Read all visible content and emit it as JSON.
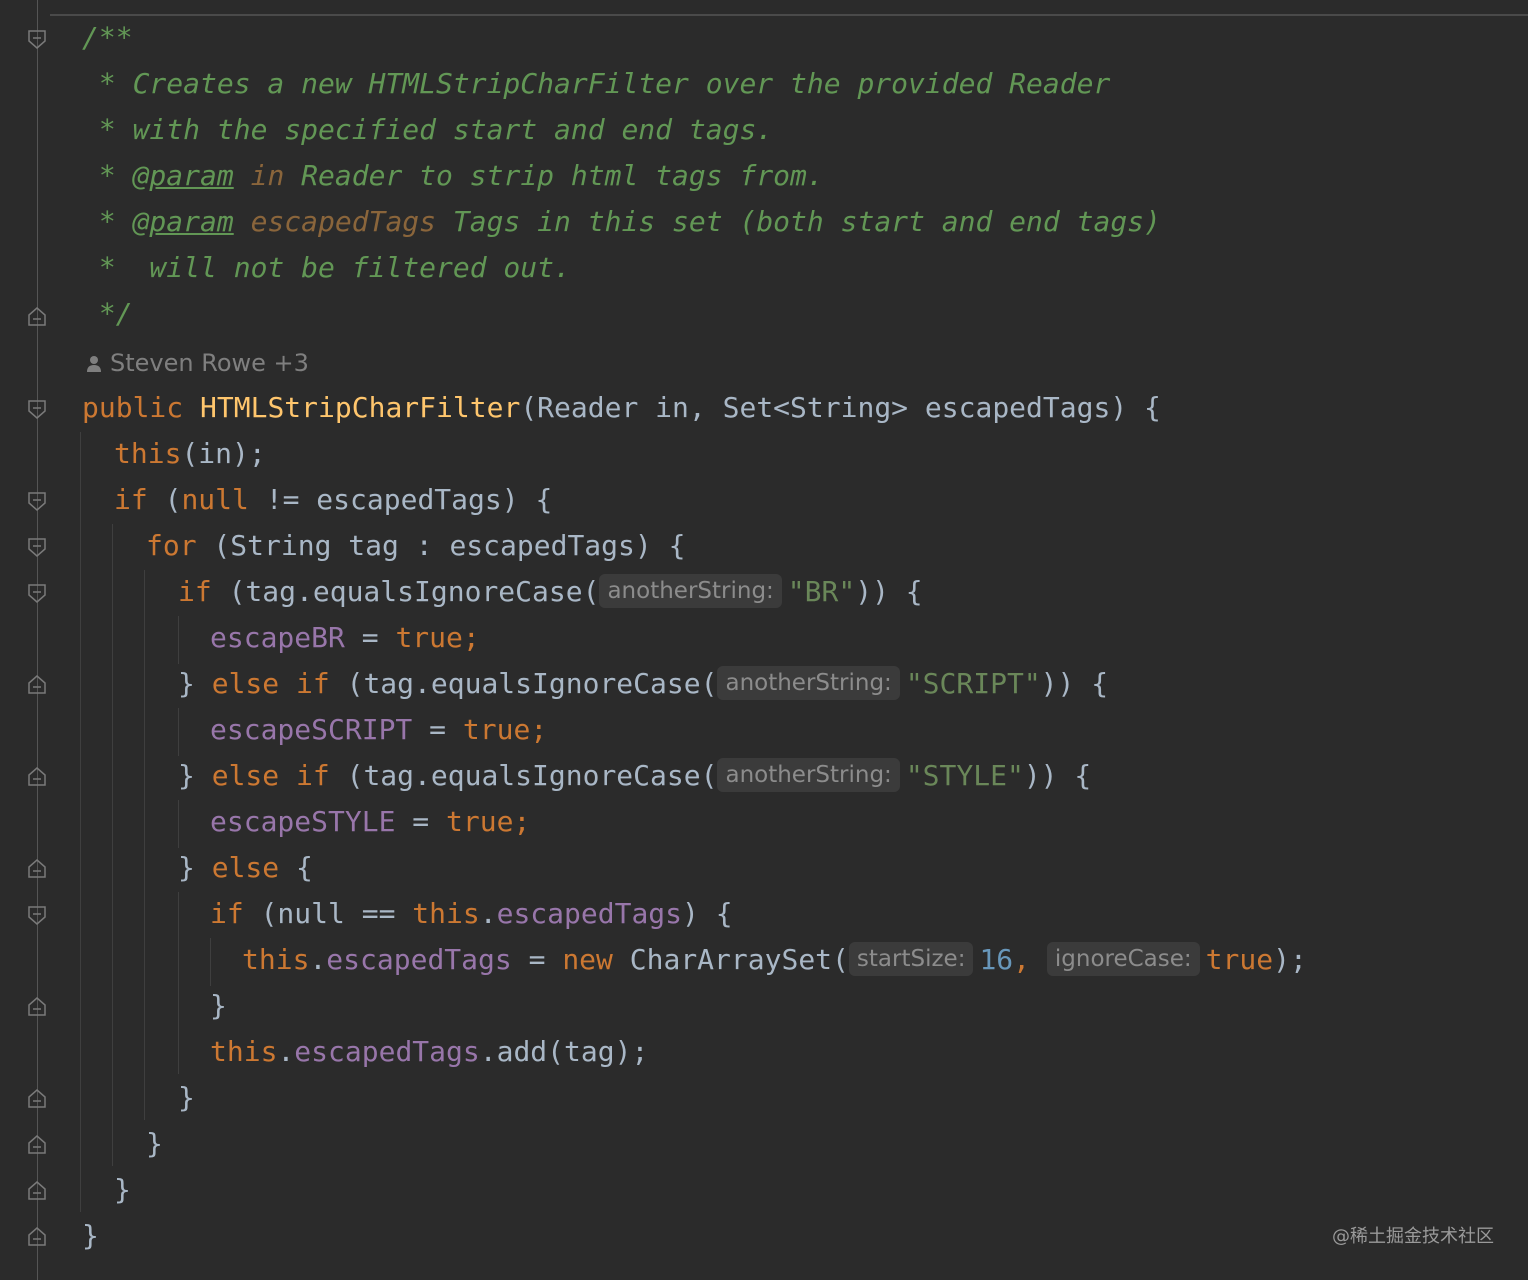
{
  "editor": {
    "author_annotation": "Steven Rowe +3",
    "watermark": "@稀土掘金技术社区"
  },
  "doc": {
    "open": "/**",
    "line1": " * Creates a new HTMLStripCharFilter over the provided Reader",
    "line2": " * with the specified start and end tags.",
    "p1_star": " * ",
    "p1_tag": "@param",
    "p1_name": " in",
    "p1_desc": " Reader to strip html tags from.",
    "p2_star": " * ",
    "p2_tag": "@param",
    "p2_name": " escapedTags",
    "p2_desc": " Tags in this set (both start and end tags)",
    "line6": " *  will not be filtered out.",
    "close": " */"
  },
  "code": {
    "public": "public",
    "ctor": "HTMLStripCharFilter",
    "sig": "(Reader in, Set<String> escapedTags) {",
    "this": "this",
    "this_args": "(in);",
    "if": "if",
    "null": "null",
    "ne_rest": " != escapedTags) {",
    "for": "for",
    "for_rest": " (String tag : escapedTags) {",
    "equals_call": " (tag.equalsIgnoreCase(",
    "hint_anotherString": "anotherString:",
    "str_br": "\"BR\"",
    "str_script": "\"SCRIPT\"",
    "str_style": "\"STYLE\"",
    "close_if": ")) {",
    "escapeBR": "escapeBR",
    "escapeSCRIPT": "escapeSCRIPT",
    "escapeSTYLE": "escapeSTYLE",
    "assign": " = ",
    "true": "true",
    "semi": ";",
    "close_brace": "}",
    "else": "else",
    "open_brace": "{",
    "null_eq_this": " (null == ",
    "escapedTags": "escapedTags",
    "dot": ".",
    "paren_brace": ") {",
    "new": "new",
    "CharArraySet": " CharArraySet(",
    "hint_startSize": "startSize:",
    "sixteen": "16",
    "comma": ", ",
    "hint_ignoreCase": "ignoreCase:",
    "close_paren_semi": ");",
    "add_call": ".add(tag);"
  }
}
